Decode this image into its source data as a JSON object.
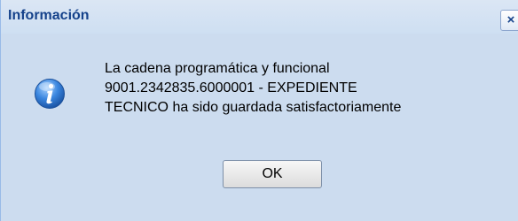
{
  "dialog": {
    "title": "Información",
    "close_symbol": "×",
    "icon": "info-icon",
    "message": "La cadena programática y funcional\n9001.2342835.6000001 - EXPEDIENTE\nTECNICO ha sido guardada satisfactoriamente",
    "ok_label": "OK"
  },
  "colors": {
    "title_text": "#15428b",
    "titlebar_bg": "#cedff2",
    "icon_blue": "#2a6fc9",
    "body_bg": "#ffffff"
  }
}
